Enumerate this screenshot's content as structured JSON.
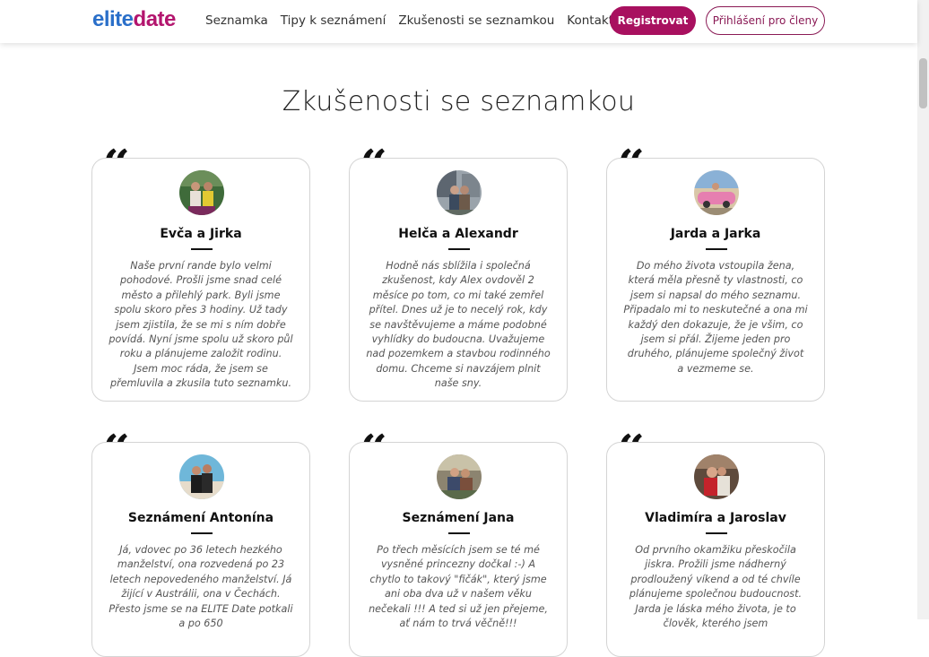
{
  "header": {
    "logo_elite": "elite",
    "logo_date": "date",
    "nav": [
      "Seznamka",
      "Tipy k seznámení",
      "Zkušenosti se seznamkou",
      "Kontakt"
    ],
    "register_label": "Registrovat",
    "login_label": "Přihlášení pro členy",
    "colors": {
      "brand_blue": "#2a6fc9",
      "brand_magenta": "#b3156e",
      "button": "#a8105f"
    }
  },
  "main": {
    "title": "Zkušenosti se seznamkou",
    "quote_glyph": "“",
    "cards": [
      {
        "name": "Evča a Jirka",
        "text": "Naše první rande bylo velmi pohodové. Prošli jsme snad celé město a přilehlý park. Byli jsme spolu skoro přes 3 hodiny. Už tady jsem zjistila, že se mi s ním dobře povídá. Nyní jsme spolu už skoro půl roku a plánujeme založit rodinu. Jsem moc ráda, že jsem se přemluvila a zkusila tuto seznamku."
      },
      {
        "name": "Helča a Alexandr",
        "text": "Hodně nás sblížila i společná zkušenost, kdy Alex ovdověl 2 měsíce po tom, co mi také zemřel přítel. Dnes už je to necelý rok, kdy se navštěvujeme a máme podobné vyhlídky do budoucna. Uvažujeme nad pozemkem a stavbou rodinného domu. Chceme si navzájem plnit naše sny."
      },
      {
        "name": "Jarda a Jarka",
        "text": "Do mého života vstoupila žena, která měla přesně ty vlastnosti, co jsem si napsal do mého seznamu. Připadalo mi to neskutečné a ona mi každý den dokazuje, že je všim, co jsem si přál. Žijeme jeden pro druhého, plánujeme společný život a vezmeme se."
      },
      {
        "name": "Seznámení Antonína",
        "text": "Já, vdovec po 36 letech hezkého manželství, ona rozvedená po 23 letech nepovedeného manželství. Já žijící v Austrálii, ona v Čechách. Přesto jsme se na ELITE Date potkali a po 650"
      },
      {
        "name": "Seznámení Jana",
        "text": "Po třech měsících jsem se té mé vysněné princezny dočkal :-) A chytlo to takový \"fičák\", který jsme ani oba dva už v našem věku nečekali !!! A ted si už jen přejeme, ať nám to trvá věčně!!!"
      },
      {
        "name": "Vladimíra a Jaroslav",
        "text": "Od prvního okamžiku přeskočila jiskra. Prožili jsme nádherný prodloužený víkend a od té chvíle plánujeme společnou budoucnost. Jarda je láska mého života, je to člověk, kterého jsem"
      }
    ]
  }
}
